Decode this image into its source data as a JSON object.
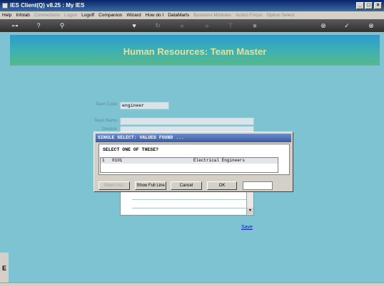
{
  "window": {
    "title": "IES Client(Q) v8.25 : My IES",
    "minimize": "_",
    "maximize": "□",
    "close": "×"
  },
  "menu": [
    {
      "label": "Help",
      "enabled": true
    },
    {
      "label": "Infolab",
      "enabled": true
    },
    {
      "label": "Connections",
      "enabled": false
    },
    {
      "label": "Logon",
      "enabled": false
    },
    {
      "label": "Logoff",
      "enabled": true
    },
    {
      "label": "Companion",
      "enabled": true
    },
    {
      "label": "Wizard",
      "enabled": true
    },
    {
      "label": "How do I",
      "enabled": true
    },
    {
      "label": "DataMarts",
      "enabled": true
    },
    {
      "label": "Business Modules",
      "enabled": false
    },
    {
      "label": "Action Focus",
      "enabled": false
    },
    {
      "label": "Option Select",
      "enabled": false
    }
  ],
  "toolbar": {
    "key_glyph": "⊶",
    "help_glyph": "?",
    "search_glyph": "⚲",
    "heart_glyph": "♥",
    "refresh_glyph": "↻",
    "back_glyph": "«",
    "forward_glyph": "»",
    "filter_glyph": "⊤",
    "stop_glyph": "■",
    "plus_glyph": "⊕",
    "check_glyph": "✓",
    "close_glyph": "⊗"
  },
  "page": {
    "title": "Human Resources: Team Master",
    "team_code_label": "Team Code",
    "team_code_value": "engineer",
    "team_name_label": "Team Name",
    "division_label": "Division",
    "save_link": "Save",
    "side_glyph": "E"
  },
  "dialog": {
    "title": "SINGLE SELECT: VALUES FOUND ...",
    "prompt": "SELECT ONE OF THESE?",
    "rows": [
      {
        "index": "1",
        "code": "0101",
        "description": "Electrical Engineers"
      }
    ],
    "buttons": {
      "select_all": "Select ALL",
      "show_full_line": "Show Full Line",
      "cancel": "Cancel",
      "ok": "OK"
    }
  }
}
